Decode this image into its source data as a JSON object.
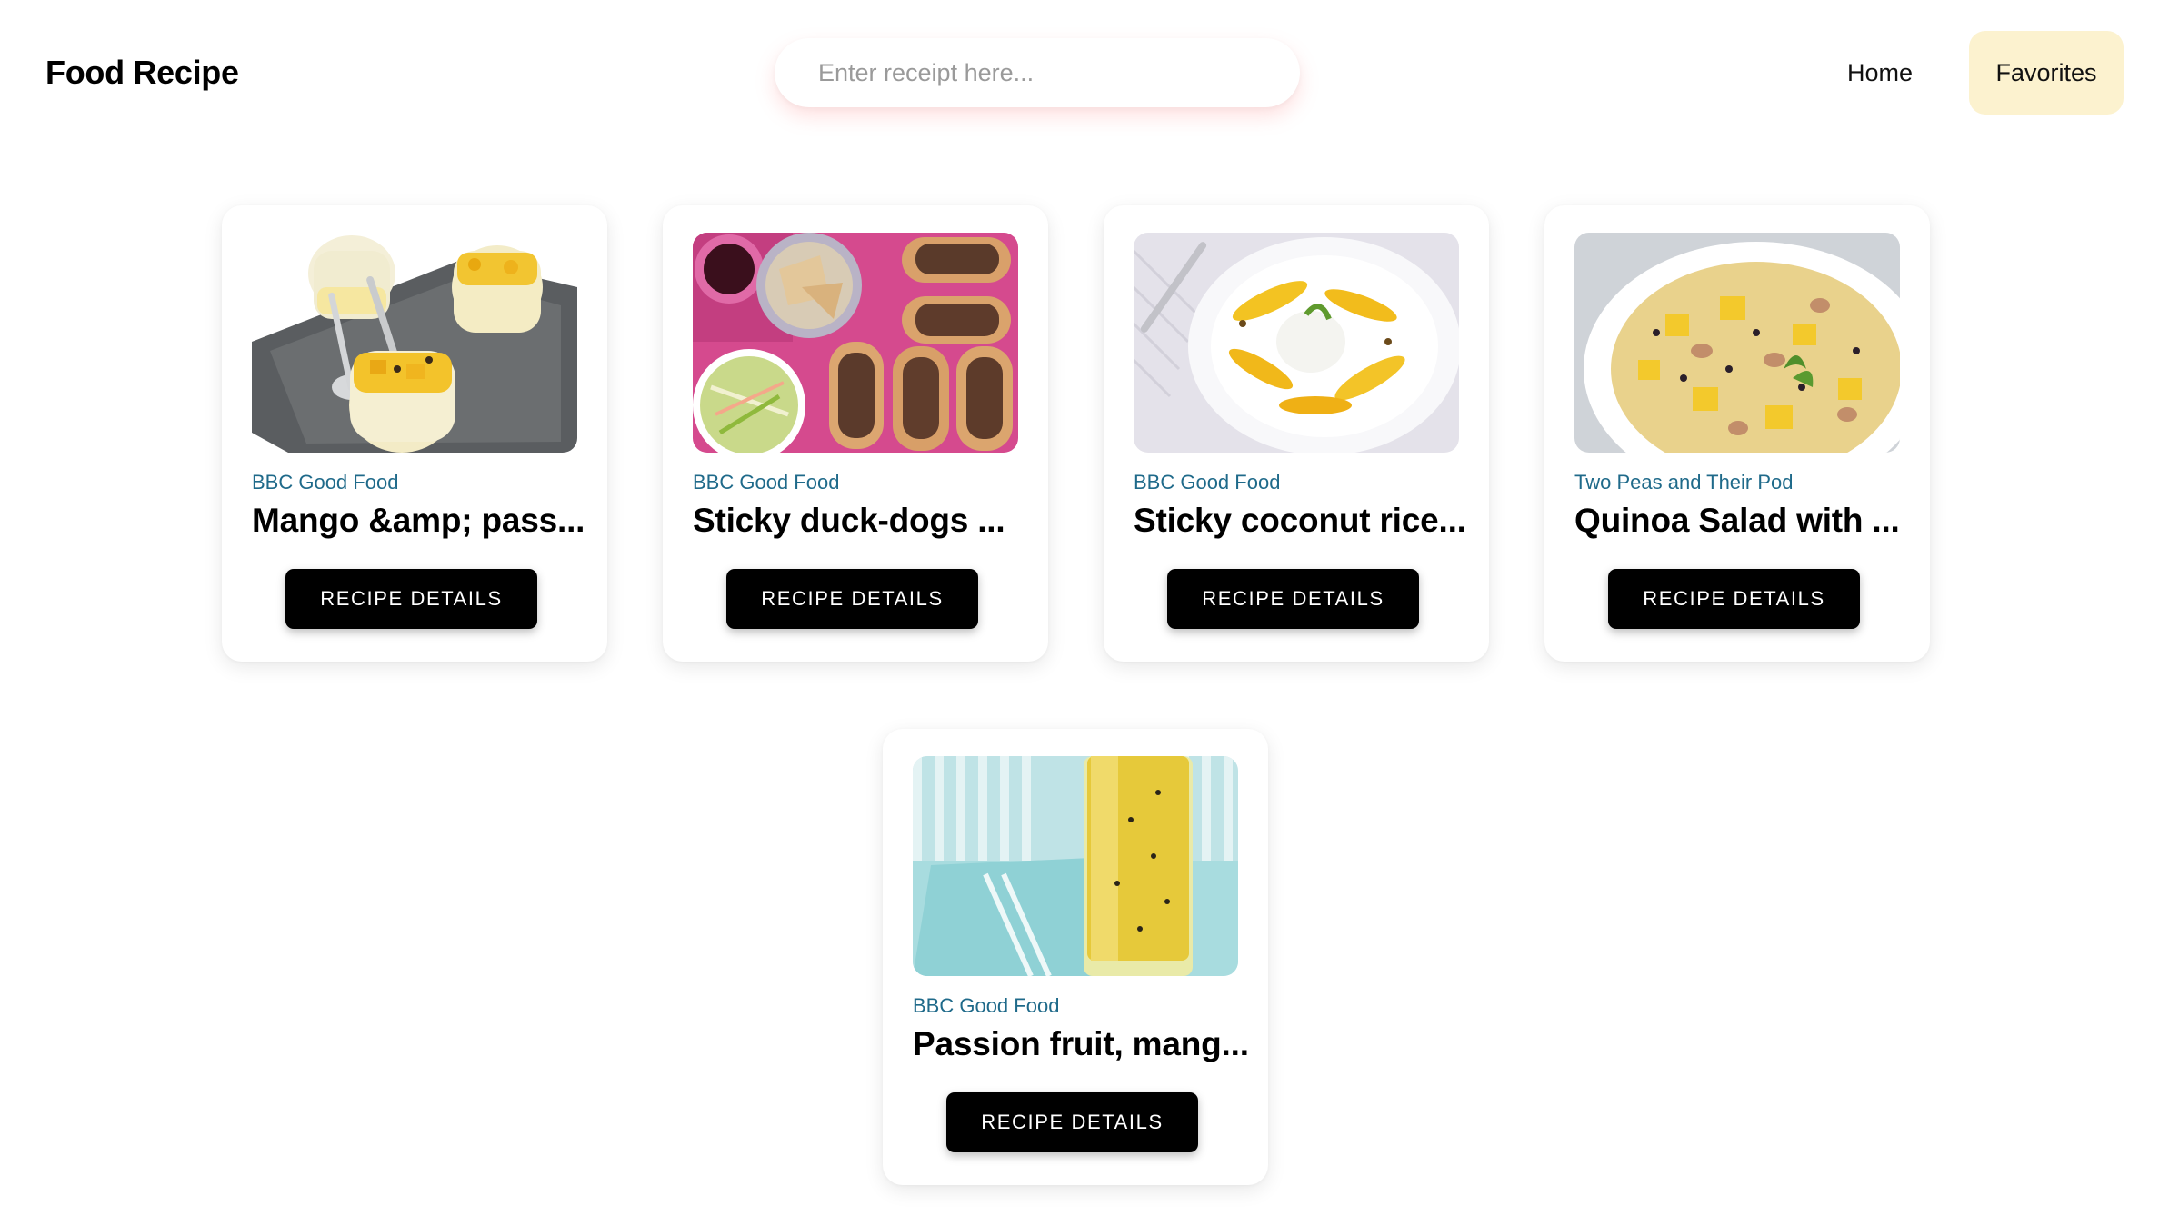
{
  "header": {
    "brand": "Food Recipe",
    "search": {
      "placeholder": "Enter receipt here...",
      "value": ""
    },
    "nav": {
      "home": "Home",
      "favorites": "Favorites"
    },
    "active_nav_color": "#fcf2cf"
  },
  "recipes": [
    {
      "source": "BBC Good Food",
      "title": "Mango &amp; pass...",
      "button": "RECIPE DETAILS",
      "image": "mango-passion-fruit-dessert-image"
    },
    {
      "source": "BBC Good Food",
      "title": "Sticky duck-dogs ...",
      "button": "RECIPE DETAILS",
      "image": "duck-dogs-image"
    },
    {
      "source": "BBC Good Food",
      "title": "Sticky coconut rice...",
      "button": "RECIPE DETAILS",
      "image": "coconut-rice-mango-image"
    },
    {
      "source": "Two Peas and Their Pod",
      "title": "Quinoa Salad with ...",
      "button": "RECIPE DETAILS",
      "image": "quinoa-salad-image"
    },
    {
      "source": "BBC Good Food",
      "title": "Passion fruit, mang...",
      "button": "RECIPE DETAILS",
      "image": "passion-fruit-smoothie-image"
    }
  ],
  "colors": {
    "source_text": "#1f6a8a",
    "button_bg": "#000000",
    "button_text": "#ffffff"
  }
}
